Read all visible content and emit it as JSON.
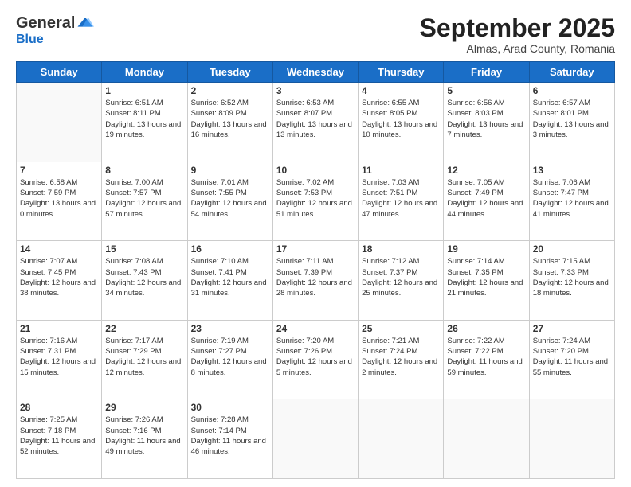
{
  "header": {
    "logo": {
      "general": "General",
      "blue": "Blue"
    },
    "month": "September 2025",
    "location": "Almas, Arad County, Romania"
  },
  "days_of_week": [
    "Sunday",
    "Monday",
    "Tuesday",
    "Wednesday",
    "Thursday",
    "Friday",
    "Saturday"
  ],
  "weeks": [
    [
      {
        "day": "",
        "info": ""
      },
      {
        "day": "1",
        "info": "Sunrise: 6:51 AM\nSunset: 8:11 PM\nDaylight: 13 hours and 19 minutes."
      },
      {
        "day": "2",
        "info": "Sunrise: 6:52 AM\nSunset: 8:09 PM\nDaylight: 13 hours and 16 minutes."
      },
      {
        "day": "3",
        "info": "Sunrise: 6:53 AM\nSunset: 8:07 PM\nDaylight: 13 hours and 13 minutes."
      },
      {
        "day": "4",
        "info": "Sunrise: 6:55 AM\nSunset: 8:05 PM\nDaylight: 13 hours and 10 minutes."
      },
      {
        "day": "5",
        "info": "Sunrise: 6:56 AM\nSunset: 8:03 PM\nDaylight: 13 hours and 7 minutes."
      },
      {
        "day": "6",
        "info": "Sunrise: 6:57 AM\nSunset: 8:01 PM\nDaylight: 13 hours and 3 minutes."
      }
    ],
    [
      {
        "day": "7",
        "info": "Sunrise: 6:58 AM\nSunset: 7:59 PM\nDaylight: 13 hours and 0 minutes."
      },
      {
        "day": "8",
        "info": "Sunrise: 7:00 AM\nSunset: 7:57 PM\nDaylight: 12 hours and 57 minutes."
      },
      {
        "day": "9",
        "info": "Sunrise: 7:01 AM\nSunset: 7:55 PM\nDaylight: 12 hours and 54 minutes."
      },
      {
        "day": "10",
        "info": "Sunrise: 7:02 AM\nSunset: 7:53 PM\nDaylight: 12 hours and 51 minutes."
      },
      {
        "day": "11",
        "info": "Sunrise: 7:03 AM\nSunset: 7:51 PM\nDaylight: 12 hours and 47 minutes."
      },
      {
        "day": "12",
        "info": "Sunrise: 7:05 AM\nSunset: 7:49 PM\nDaylight: 12 hours and 44 minutes."
      },
      {
        "day": "13",
        "info": "Sunrise: 7:06 AM\nSunset: 7:47 PM\nDaylight: 12 hours and 41 minutes."
      }
    ],
    [
      {
        "day": "14",
        "info": "Sunrise: 7:07 AM\nSunset: 7:45 PM\nDaylight: 12 hours and 38 minutes."
      },
      {
        "day": "15",
        "info": "Sunrise: 7:08 AM\nSunset: 7:43 PM\nDaylight: 12 hours and 34 minutes."
      },
      {
        "day": "16",
        "info": "Sunrise: 7:10 AM\nSunset: 7:41 PM\nDaylight: 12 hours and 31 minutes."
      },
      {
        "day": "17",
        "info": "Sunrise: 7:11 AM\nSunset: 7:39 PM\nDaylight: 12 hours and 28 minutes."
      },
      {
        "day": "18",
        "info": "Sunrise: 7:12 AM\nSunset: 7:37 PM\nDaylight: 12 hours and 25 minutes."
      },
      {
        "day": "19",
        "info": "Sunrise: 7:14 AM\nSunset: 7:35 PM\nDaylight: 12 hours and 21 minutes."
      },
      {
        "day": "20",
        "info": "Sunrise: 7:15 AM\nSunset: 7:33 PM\nDaylight: 12 hours and 18 minutes."
      }
    ],
    [
      {
        "day": "21",
        "info": "Sunrise: 7:16 AM\nSunset: 7:31 PM\nDaylight: 12 hours and 15 minutes."
      },
      {
        "day": "22",
        "info": "Sunrise: 7:17 AM\nSunset: 7:29 PM\nDaylight: 12 hours and 12 minutes."
      },
      {
        "day": "23",
        "info": "Sunrise: 7:19 AM\nSunset: 7:27 PM\nDaylight: 12 hours and 8 minutes."
      },
      {
        "day": "24",
        "info": "Sunrise: 7:20 AM\nSunset: 7:26 PM\nDaylight: 12 hours and 5 minutes."
      },
      {
        "day": "25",
        "info": "Sunrise: 7:21 AM\nSunset: 7:24 PM\nDaylight: 12 hours and 2 minutes."
      },
      {
        "day": "26",
        "info": "Sunrise: 7:22 AM\nSunset: 7:22 PM\nDaylight: 11 hours and 59 minutes."
      },
      {
        "day": "27",
        "info": "Sunrise: 7:24 AM\nSunset: 7:20 PM\nDaylight: 11 hours and 55 minutes."
      }
    ],
    [
      {
        "day": "28",
        "info": "Sunrise: 7:25 AM\nSunset: 7:18 PM\nDaylight: 11 hours and 52 minutes."
      },
      {
        "day": "29",
        "info": "Sunrise: 7:26 AM\nSunset: 7:16 PM\nDaylight: 11 hours and 49 minutes."
      },
      {
        "day": "30",
        "info": "Sunrise: 7:28 AM\nSunset: 7:14 PM\nDaylight: 11 hours and 46 minutes."
      },
      {
        "day": "",
        "info": ""
      },
      {
        "day": "",
        "info": ""
      },
      {
        "day": "",
        "info": ""
      },
      {
        "day": "",
        "info": ""
      }
    ]
  ]
}
